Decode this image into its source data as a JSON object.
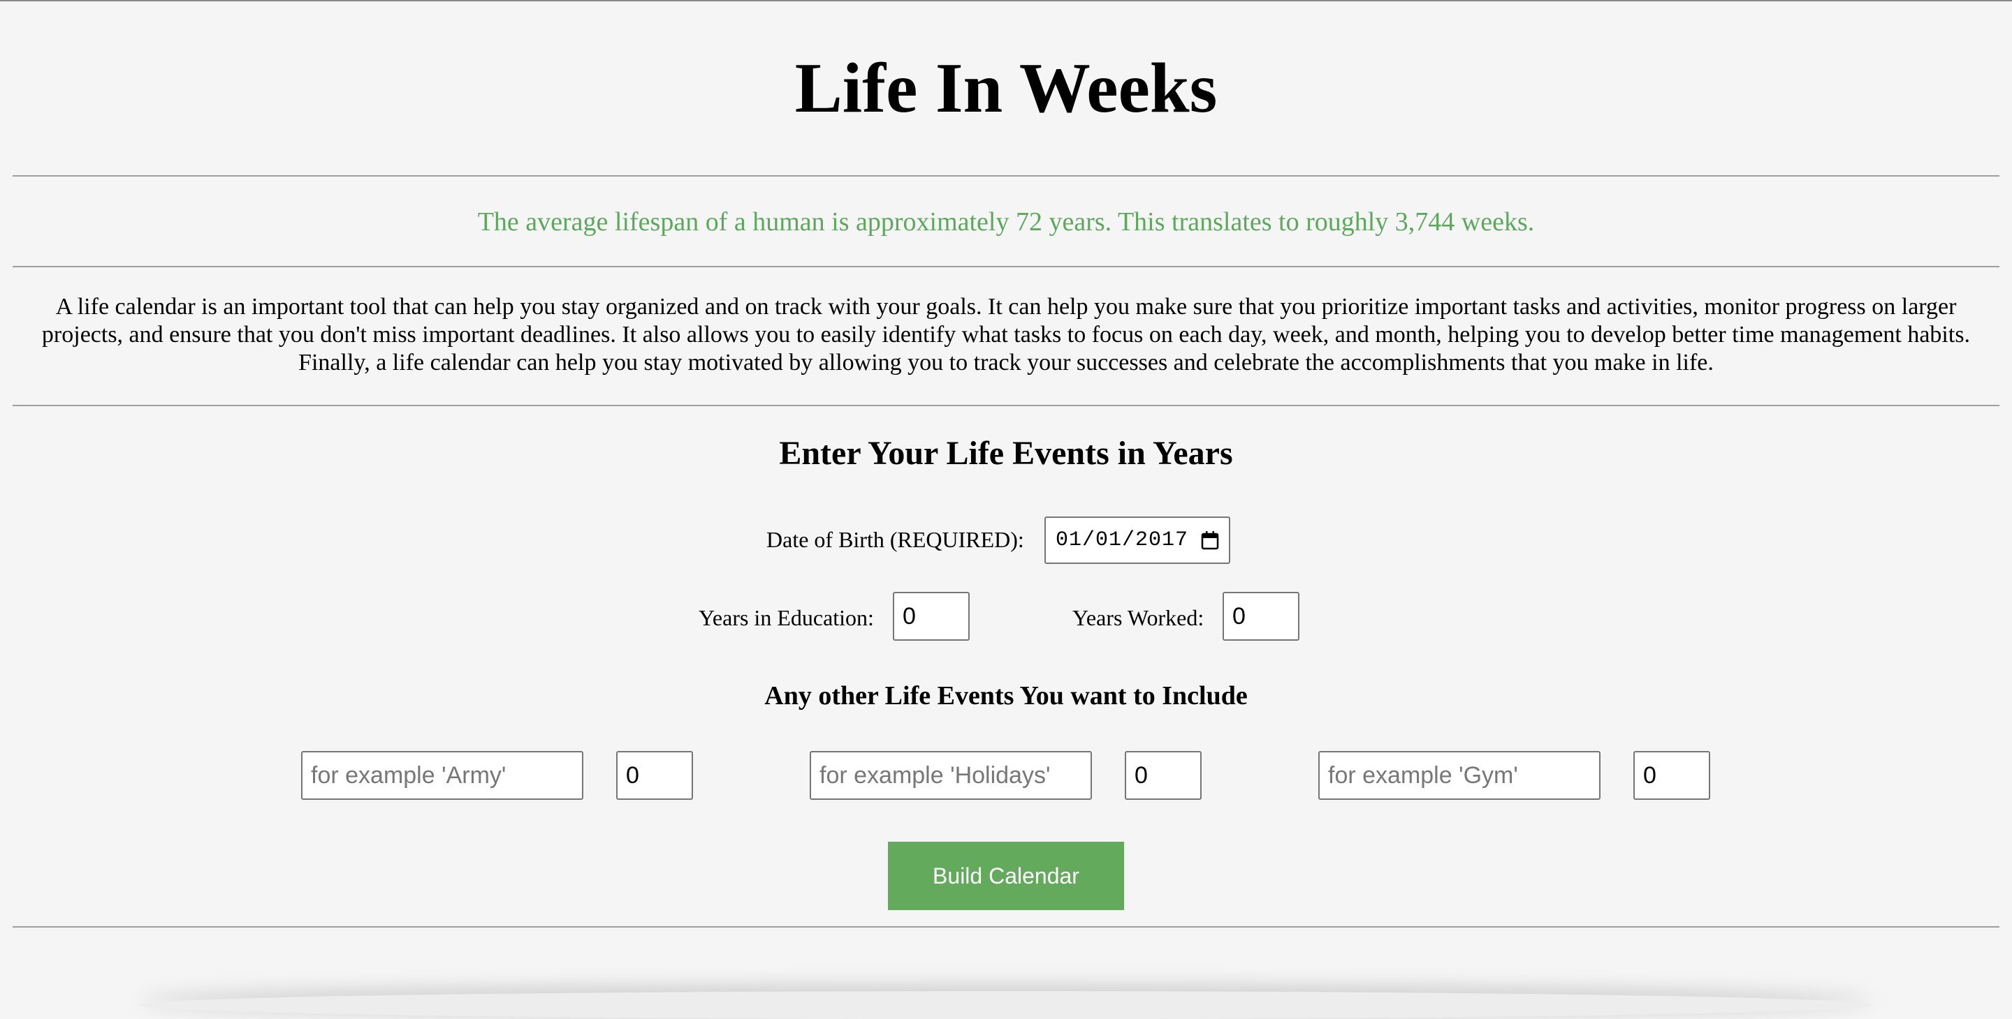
{
  "header": {
    "title": "Life In Weeks"
  },
  "lifespan_text": "The average lifespan of a human is approximately 72 years. This translates to roughly 3,744 weeks.",
  "intro_text": "A life calendar is an important tool that can help you stay organized and on track with your goals. It can help you make sure that you prioritize important tasks and activities, monitor progress on larger projects, and ensure that you don't miss important deadlines. It also allows you to easily identify what tasks to focus on each day, week, and month, helping you to develop better time management habits. Finally, a life calendar can help you stay motivated by allowing you to track your successes and celebrate the accomplishments that you make in life.",
  "form": {
    "heading": "Enter Your Life Events in Years",
    "dob_label": "Date of Birth (REQUIRED):",
    "dob_value": "01/01/2017",
    "education_label": "Years in Education:",
    "education_value": "0",
    "worked_label": "Years Worked:",
    "worked_value": "0",
    "other_heading": "Any other Life Events You want to Include",
    "events": [
      {
        "placeholder": "for example 'Army'",
        "value": "0"
      },
      {
        "placeholder": "for example 'Holidays'",
        "value": "0"
      },
      {
        "placeholder": "for example 'Gym'",
        "value": "0"
      }
    ],
    "button_label": "Build Calendar"
  },
  "colors": {
    "accent_green": "#64aa5c",
    "lifespan_text": "#5da85d",
    "background": "#f5f5f5"
  }
}
